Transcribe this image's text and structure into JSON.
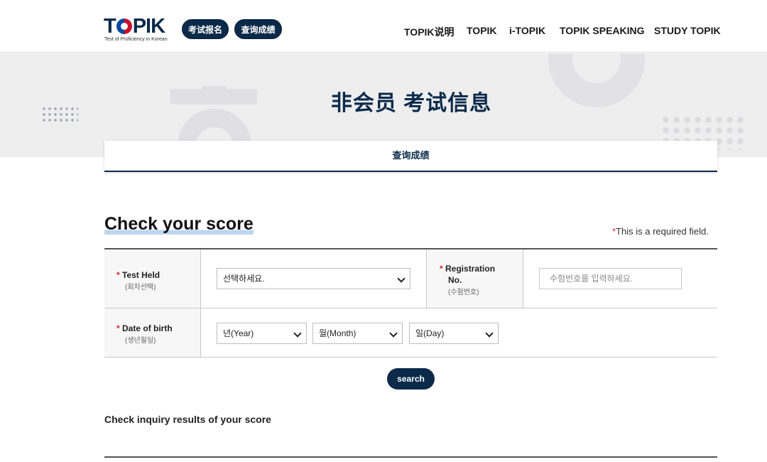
{
  "header": {
    "logo_text": "TOPIK",
    "logo_subtitle": "Test of Proficiency in Korean",
    "pill_buttons": [
      "考试报名",
      "查询成绩"
    ],
    "nav": [
      "TOPIK说明",
      "TOPIK",
      "i-TOPIK",
      "TOPIK SPEAKING",
      "STUDY TOPIK"
    ]
  },
  "banner": {
    "title": "非会员 考试信息"
  },
  "subtab": {
    "label": "查询成绩"
  },
  "section": {
    "title": "Check your score",
    "required_star": "*",
    "required_note": "This is a required field."
  },
  "form": {
    "test_held": {
      "star": "*",
      "label": "Test Held",
      "sublabel": "(회차선택)",
      "value": "선택하세요."
    },
    "registration": {
      "star": "*",
      "label_line1": "Registration",
      "label_line2": "No.",
      "sublabel": "(수험번호)",
      "placeholder": "수험번호를 입력하세요."
    },
    "dob": {
      "star": "*",
      "label": "Date of birth",
      "sublabel": "(생년월일)",
      "year": "년(Year)",
      "month": "월(Month)",
      "day": "일(Day)"
    }
  },
  "search_button": "search",
  "results": {
    "title": "Check inquiry results of your score"
  },
  "colors": {
    "primary": "#0b2a4a",
    "required": "#d62828",
    "banner_bg": "#eeeeef"
  }
}
